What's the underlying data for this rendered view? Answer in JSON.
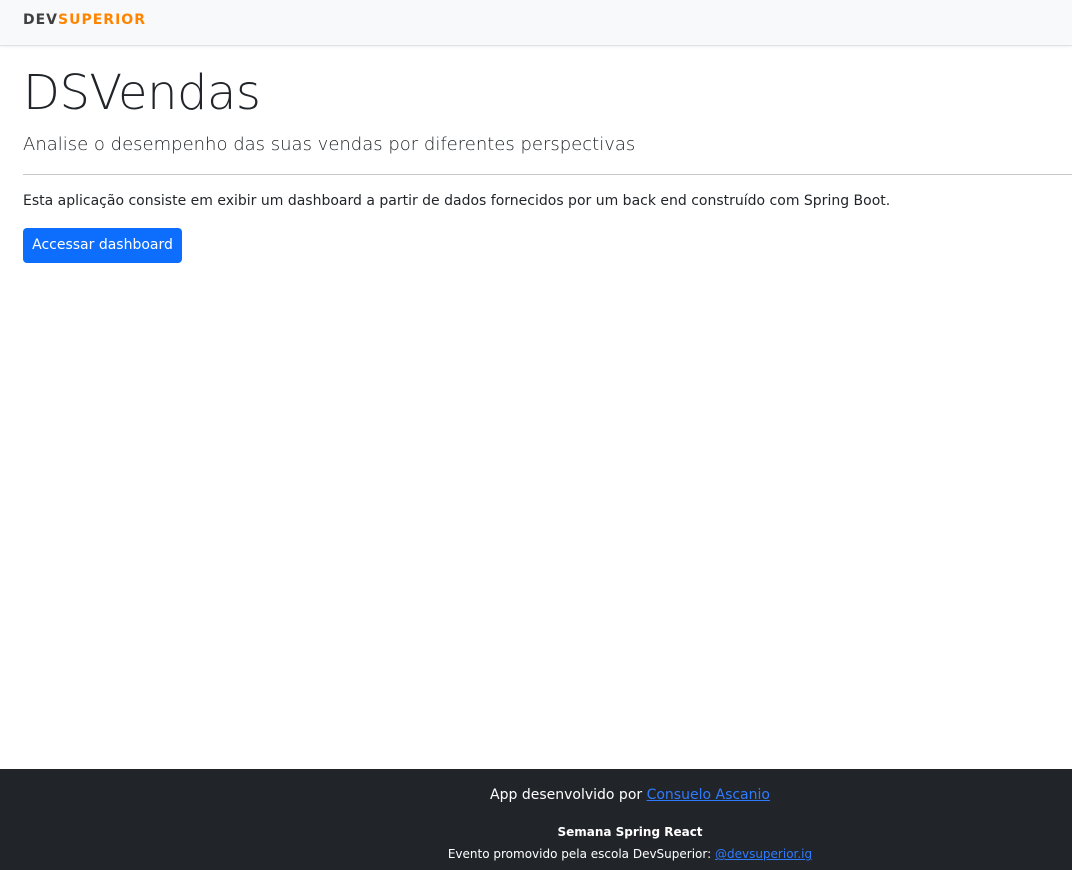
{
  "navbar": {
    "brand_prefix": "DEV",
    "brand_suffix": "SUPERIOR",
    "brand_prefix_color": "#404040",
    "brand_suffix_color": "#ff8400"
  },
  "main": {
    "title": "DSVendas",
    "subtitle": "Analise o desempenho das suas vendas por diferentes perspectivas",
    "description": "Esta aplicação consiste em exibir um dashboard a partir de dados fornecidos por um back end construído com Spring Boot.",
    "button_label": "Accessar dashboard",
    "button_color": "#0d6efd"
  },
  "footer": {
    "developed_by_text": "App desenvolvido por ",
    "developer_name": "Consuelo Ascanio",
    "event_title": "Semana Spring React",
    "event_text": "Evento promovido pela escola DevSuperior: ",
    "instagram_handle": "@devsuperior.ig",
    "background_color": "#212529",
    "link_color": "#2f7bff"
  }
}
